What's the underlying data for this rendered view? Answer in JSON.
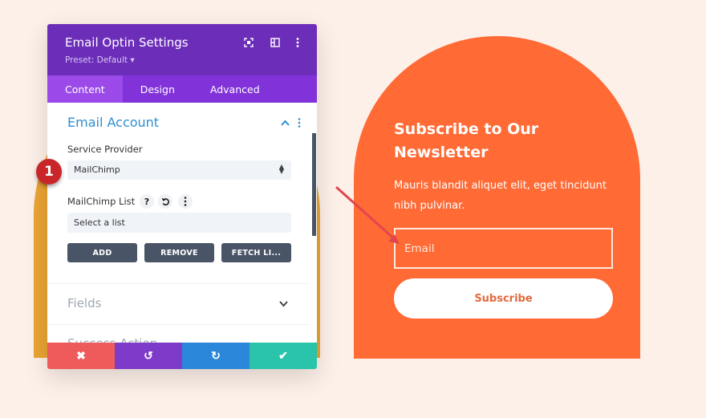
{
  "colors": {
    "page_bg": "#fdf0e9",
    "yellow_arch": "#eaa432",
    "orange_arch": "#ff6a35",
    "panel_header": "#6c2eb9",
    "tab_bar": "#8133d9",
    "tab_active": "#9b4ae9",
    "accent_blue": "#2e8fd1",
    "button_dark": "#4a5467",
    "footer_cancel": "#ef5a5a",
    "footer_undo": "#7e3bc9",
    "footer_redo": "#2b87da",
    "footer_save": "#29c4a9",
    "badge": "#c9262a",
    "arrow": "#e0474c"
  },
  "panel": {
    "title": "Email Optin Settings",
    "preset": "Preset: Default ▾",
    "header_icons": [
      "focus-icon",
      "split-view-icon",
      "more-options-icon"
    ],
    "tabs": [
      {
        "label": "Content",
        "active": true
      },
      {
        "label": "Design",
        "active": false
      },
      {
        "label": "Advanced",
        "active": false
      }
    ],
    "email_account": {
      "title": "Email Account",
      "service_provider_label": "Service Provider",
      "service_provider_value": "MailChimp",
      "list_label": "MailChimp List",
      "list_placeholder": "Select a list",
      "buttons": {
        "add": "ADD",
        "remove": "REMOVE",
        "fetch": "FETCH LI..."
      }
    },
    "sections": [
      {
        "title": "Fields"
      },
      {
        "title": "Success Action"
      }
    ],
    "footer": {
      "cancel": "✖",
      "undo": "↺",
      "redo": "↻",
      "save": "✔"
    }
  },
  "badge": {
    "number": "1"
  },
  "newsletter": {
    "title": "Subscribe to Our Newsletter",
    "text": "Mauris blandit aliquet elit, eget tincidunt nibh pulvinar.",
    "email_placeholder": "Email",
    "subscribe_label": "Subscribe"
  }
}
